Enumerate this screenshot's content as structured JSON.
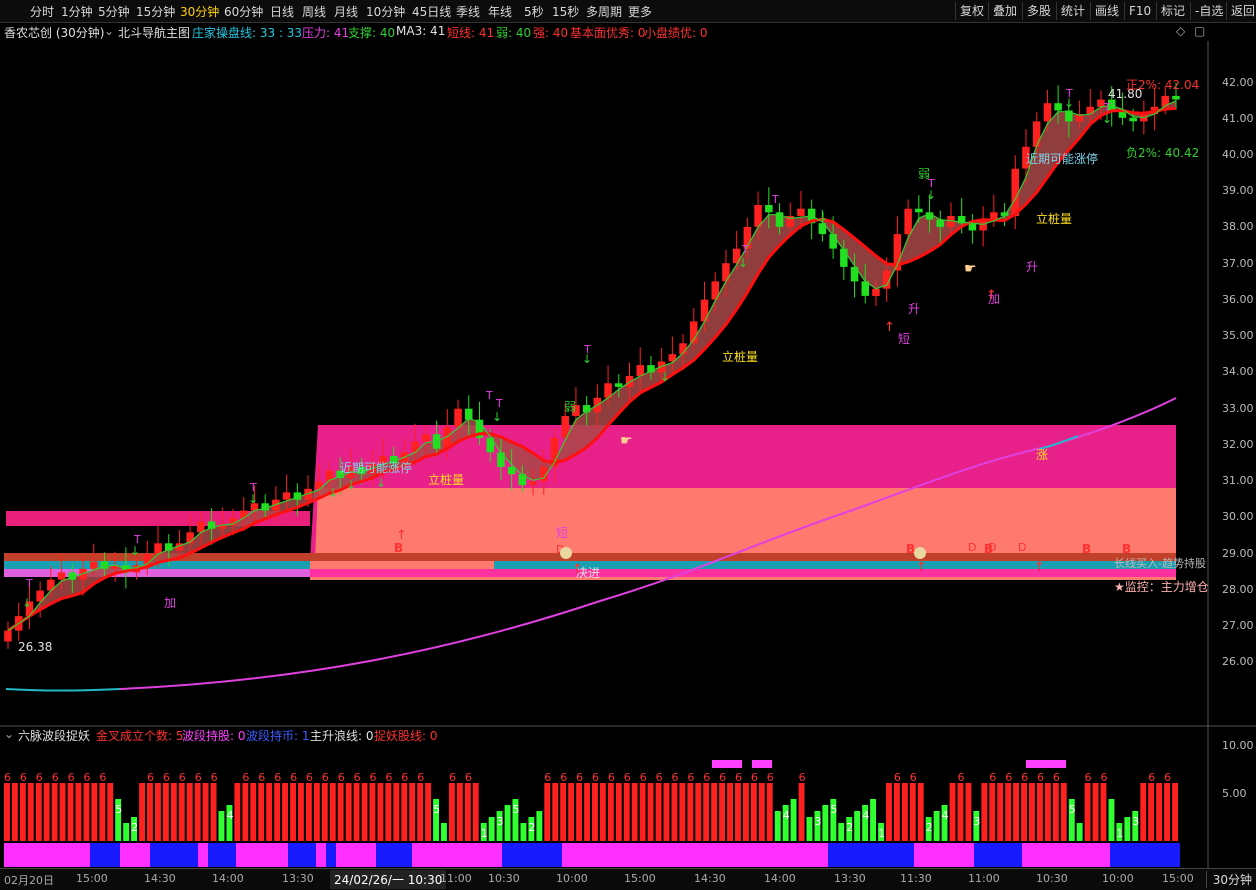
{
  "toolbar": {
    "periods": [
      "分时",
      "1分钟",
      "5分钟",
      "15分钟",
      "30分钟",
      "60分钟",
      "日线",
      "周线",
      "月线",
      "10分钟",
      "45日线",
      "季线",
      "年线",
      "5秒",
      "15秒",
      "多周期",
      "更多"
    ],
    "active_period": "30分钟",
    "right_buttons": [
      "复权",
      "叠加",
      "多股",
      "统计",
      "画线",
      "F10",
      "标记",
      "-自选",
      "返回"
    ]
  },
  "legend": {
    "stock": "香农芯创 (30分钟)",
    "indicator": "北斗导航主图",
    "items": [
      {
        "text": "庄家操盘线: 33 : 33",
        "color": "#22c8e0"
      },
      {
        "text": "压力: 41",
        "color": "#e040e0"
      },
      {
        "text": "支撑: 40",
        "color": "#30d030"
      },
      {
        "text": "MA3: 41",
        "color": "#e0e0e0"
      },
      {
        "text": "短线: 41",
        "color": "#ff3030"
      },
      {
        "text": "弱: 40",
        "color": "#30d030"
      },
      {
        "text": "强: 40",
        "color": "#ff3030"
      },
      {
        "text": "基本面优秀: 0",
        "color": "#ff3030"
      },
      {
        "text": "小盘绩优: 0",
        "color": "#ff3030"
      }
    ]
  },
  "price_axis": {
    "ticks": [
      "42.00",
      "41.00",
      "40.00",
      "39.00",
      "38.00",
      "37.00",
      "36.00",
      "35.00",
      "34.00",
      "33.00",
      "32.00",
      "31.00",
      "30.00",
      "29.00",
      "28.00",
      "27.00",
      "26.00"
    ]
  },
  "annotations": {
    "high_value": "41.80",
    "low_value": "26.38",
    "upper_limit": "正2%: 42.04",
    "lower_limit": "负2%: 40.42",
    "monitor": "★监控：主力增仓",
    "labels": [
      {
        "text": "近期可能涨停",
        "kind": "cyan"
      },
      {
        "text": "立桩量",
        "kind": "yellow"
      },
      {
        "text": "立桩量",
        "kind": "yellow"
      },
      {
        "text": "近期可能涨停",
        "kind": "cyan"
      },
      {
        "text": "立桩量",
        "kind": "yellow"
      },
      {
        "text": "加",
        "kind": "magenta"
      },
      {
        "text": "短",
        "kind": "magenta"
      },
      {
        "text": "弱",
        "kind": "green"
      },
      {
        "text": "弱",
        "kind": "green"
      },
      {
        "text": "短",
        "kind": "magenta"
      },
      {
        "text": "升",
        "kind": "magenta"
      },
      {
        "text": "加",
        "kind": "magenta"
      },
      {
        "text": "升",
        "kind": "magenta"
      },
      {
        "text": "涨",
        "kind": "yellow"
      },
      {
        "text": "决进",
        "kind": "white"
      },
      {
        "text": "长线买入-趋势持股",
        "kind": "grey"
      }
    ]
  },
  "sub_legend": {
    "title": "六脉波段捉妖",
    "items": [
      {
        "text": "金叉成立个数: 5",
        "color": "#ff3030"
      },
      {
        "text": "波段持股: 0",
        "color": "#ff40ff"
      },
      {
        "text": "波段持币: 1",
        "color": "#3a5cff"
      },
      {
        "text": "主升浪线: 0",
        "color": "#e0e0e0"
      },
      {
        "text": "捉妖股线: 0",
        "color": "#ff3030"
      }
    ]
  },
  "sub_axis": {
    "ticks": [
      "10.00",
      "5.00"
    ]
  },
  "time_axis": {
    "labels": [
      "02月20日",
      "15:00",
      "14:30",
      "14:00",
      "13:30",
      "11:00",
      "10:30",
      "10:00",
      "15:00",
      "14:30",
      "14:00",
      "13:30",
      "11:30",
      "11:00",
      "10:30",
      "10:00",
      "15:00"
    ],
    "cursor_time": "24/02/26/一 10:30",
    "period": "30分钟"
  },
  "chart_data": {
    "type": "candlestick",
    "y_range": [
      25.5,
      42.6
    ],
    "closes": [
      26.5,
      26.9,
      27.3,
      27.6,
      27.9,
      28.1,
      27.9,
      28.2,
      28.4,
      28.2,
      28.3,
      28.1,
      28.3,
      28.6,
      28.9,
      28.7,
      28.9,
      29.2,
      29.5,
      29.3,
      29.4,
      29.6,
      29.8,
      30.0,
      29.8,
      30.1,
      30.3,
      30.1,
      30.4,
      30.6,
      30.9,
      30.7,
      31.0,
      30.8,
      31.1,
      31.3,
      31.1,
      31.4,
      31.7,
      31.9,
      31.5,
      32.1,
      32.6,
      32.3,
      31.8,
      31.4,
      31.0,
      30.8,
      30.5,
      30.6,
      31.0,
      31.8,
      32.4,
      32.7,
      32.5,
      32.9,
      33.3,
      33.2,
      33.5,
      33.8,
      33.6,
      33.9,
      34.1,
      34.4,
      35.0,
      35.6,
      36.1,
      36.6,
      37.0,
      37.6,
      38.2,
      38.0,
      37.6,
      37.9,
      38.1,
      37.7,
      37.4,
      37.0,
      36.5,
      36.1,
      35.7,
      35.9,
      36.4,
      37.4,
      38.1,
      38.0,
      37.8,
      37.6,
      37.9,
      37.7,
      37.5,
      37.8,
      38.0,
      37.9,
      39.2,
      39.8,
      40.5,
      41.0,
      40.8,
      40.5,
      40.7,
      40.9,
      41.1,
      40.8,
      40.6,
      40.5,
      40.7,
      40.9,
      41.2,
      41.1
    ]
  }
}
